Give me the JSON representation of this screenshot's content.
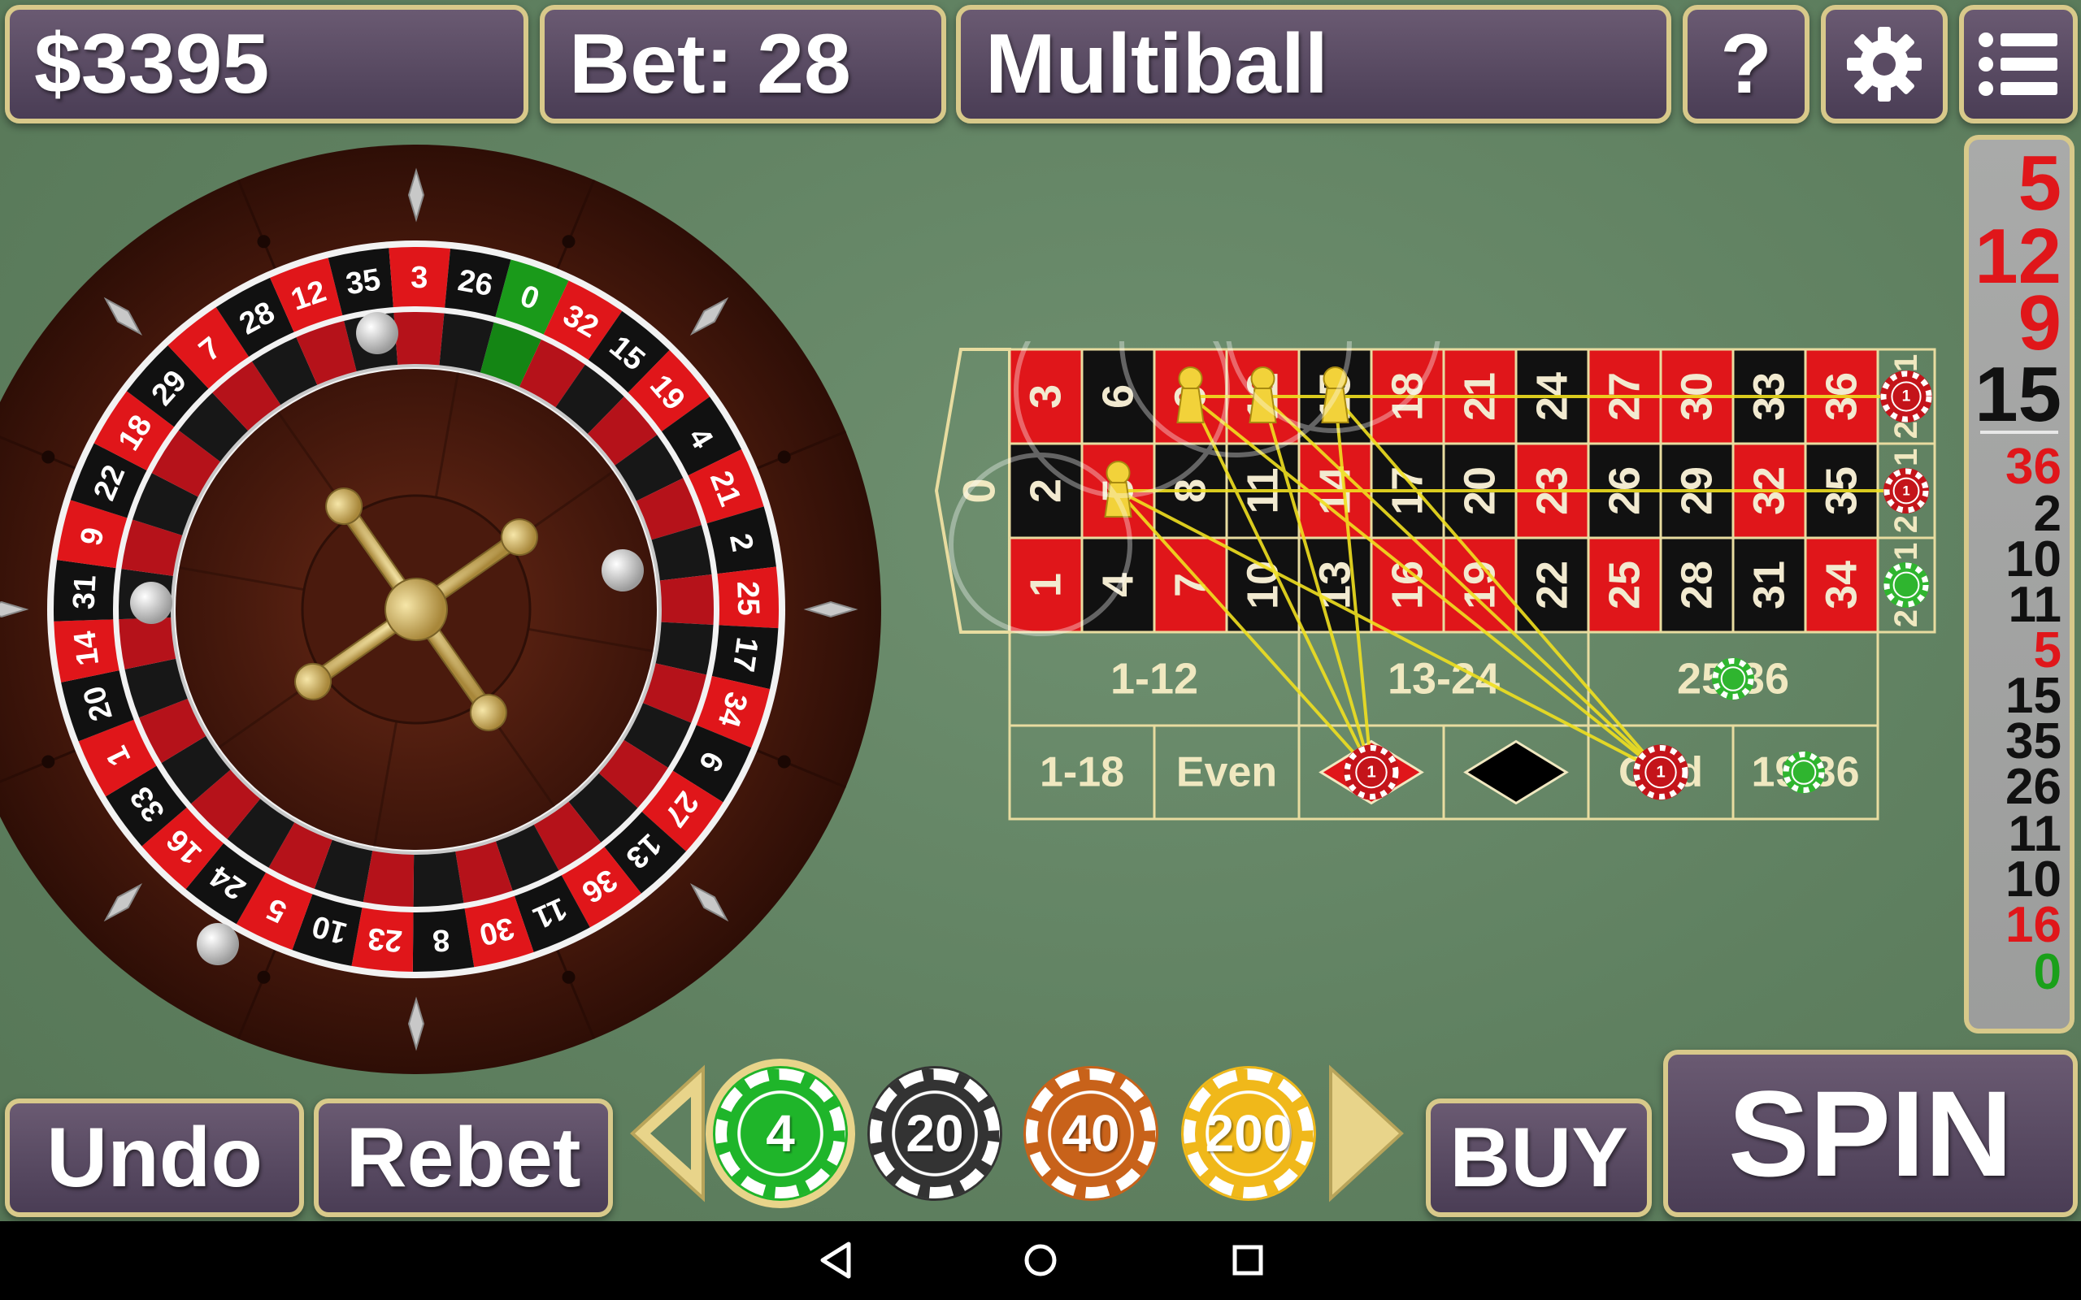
{
  "header": {
    "balance": "$3395",
    "bet": "Bet: 28",
    "mode": "Multiball",
    "help_label": "?"
  },
  "icons": {
    "help": "question-mark",
    "settings": "gear-icon",
    "menu": "list-menu-icon"
  },
  "wheel": {
    "numbers": [
      "0",
      "32",
      "15",
      "19",
      "4",
      "21",
      "2",
      "25",
      "17",
      "34",
      "6",
      "27",
      "13",
      "36",
      "11",
      "30",
      "8",
      "23",
      "10",
      "5",
      "24",
      "16",
      "33",
      "1",
      "20",
      "14",
      "31",
      "9",
      "22",
      "18",
      "29",
      "7",
      "28",
      "12",
      "35",
      "3",
      "26"
    ],
    "colors": {
      "red": "#e0161a",
      "black": "#111111",
      "green": "#1a9a1a"
    }
  },
  "table": {
    "zero": "0",
    "rows": [
      [
        "3",
        "6",
        "9",
        "12",
        "15",
        "18",
        "21",
        "24",
        "27",
        "30",
        "33",
        "36"
      ],
      [
        "2",
        "5",
        "8",
        "11",
        "14",
        "17",
        "20",
        "23",
        "26",
        "29",
        "32",
        "35"
      ],
      [
        "1",
        "4",
        "7",
        "10",
        "13",
        "16",
        "19",
        "22",
        "25",
        "28",
        "31",
        "34"
      ]
    ],
    "column_labels": [
      "2 to 1",
      "2 to 1",
      "2 to 1"
    ],
    "dozens": [
      "1-12",
      "13-24",
      "25-36"
    ],
    "outside": [
      "1-18",
      "Even",
      "red-diamond",
      "black-diamond",
      "Odd",
      "19-36"
    ],
    "chip_value_on_table": "1"
  },
  "history": {
    "items": [
      {
        "n": "5",
        "color": "red"
      },
      {
        "n": "12",
        "color": "red"
      },
      {
        "n": "9",
        "color": "red"
      },
      {
        "n": "15",
        "color": "black"
      },
      {
        "n": "36",
        "color": "red"
      },
      {
        "n": "2",
        "color": "black"
      },
      {
        "n": "10",
        "color": "black"
      },
      {
        "n": "11",
        "color": "black"
      },
      {
        "n": "5",
        "color": "red"
      },
      {
        "n": "15",
        "color": "black"
      },
      {
        "n": "35",
        "color": "black"
      },
      {
        "n": "26",
        "color": "black"
      },
      {
        "n": "11",
        "color": "black"
      },
      {
        "n": "10",
        "color": "black"
      },
      {
        "n": "16",
        "color": "red"
      },
      {
        "n": "0",
        "color": "green"
      }
    ]
  },
  "bottom": {
    "undo": "Undo",
    "rebet": "Rebet",
    "buy": "BUY",
    "spin": "SPIN",
    "chips": [
      {
        "value": "4",
        "color": "#1fb52a",
        "selected": true
      },
      {
        "value": "20",
        "color": "#333333",
        "selected": false
      },
      {
        "value": "40",
        "color": "#c8621a",
        "selected": false
      },
      {
        "value": "200",
        "color": "#f0b81a",
        "selected": false
      }
    ]
  },
  "navbar": {
    "back": "back-icon",
    "home": "home-icon",
    "recents": "recents-icon"
  }
}
